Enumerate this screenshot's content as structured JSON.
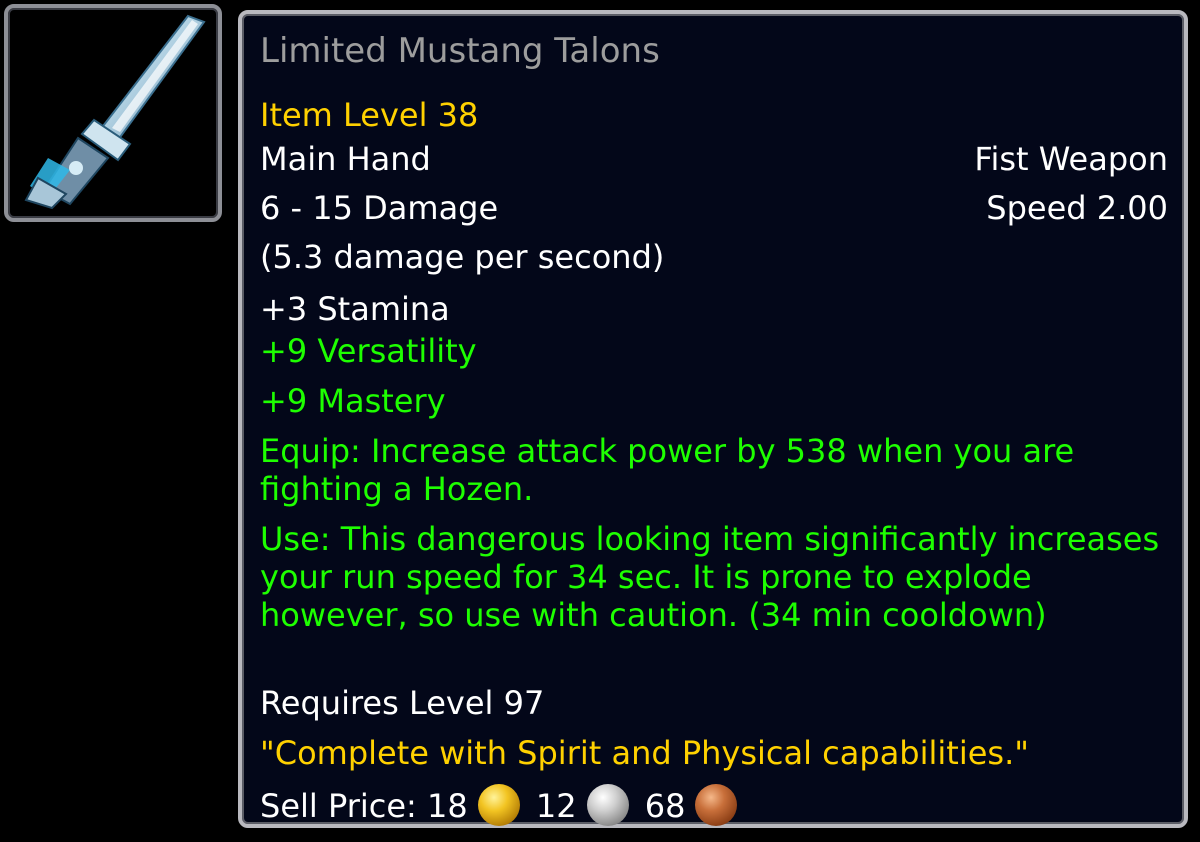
{
  "item": {
    "name": "Limited Mustang Talons",
    "item_level": "Item Level 38",
    "slot": "Main Hand",
    "weapon_type": "Fist Weapon",
    "damage": "6 - 15 Damage",
    "speed": "Speed 2.00",
    "dps": "(5.3 damage per second)",
    "stats": {
      "stamina": "+3 Stamina",
      "versatility": "+9 Versatility",
      "mastery": "+9 Mastery"
    },
    "equip_effect": "Equip: Increase attack power by 538 when you are fighting a Hozen.",
    "use_effect": "Use: This dangerous looking item significantly increases your run speed for 34 sec. It is prone to explode however, so use with caution. (34 min cooldown)",
    "requirement": "Requires Level 97",
    "flavor_text": "\"Complete with Spirit and Physical capabilities.\"",
    "sell_price": {
      "label": "Sell Price:",
      "gold": "18",
      "silver": "12",
      "copper": "68"
    },
    "icon": "fist-weapon-icon"
  },
  "colors": {
    "name_quality": "#9d9d9d",
    "item_level": "#ffd100",
    "stat_green": "#1eff00",
    "text_white": "#ffffff",
    "tooltip_bg": "#030719",
    "border": "#b9b9bf"
  }
}
